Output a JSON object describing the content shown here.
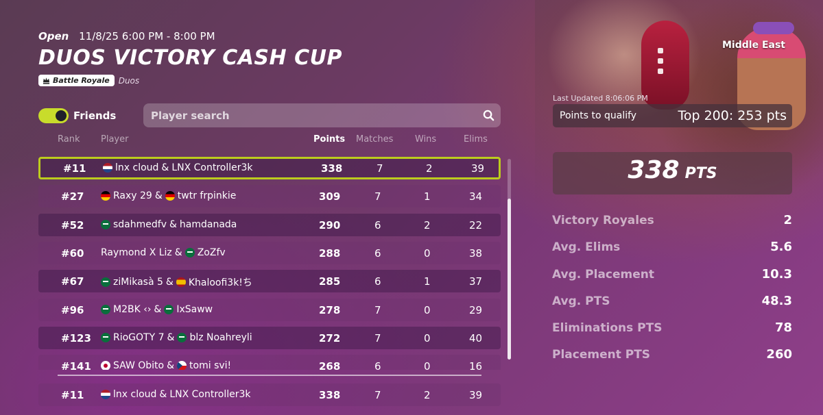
{
  "header": {
    "status": "Open",
    "time_range": "11/8/25 6:00 PM - 8:00 PM",
    "title": "DUOS VICTORY CASH CUP",
    "mode_label": "Battle Royale",
    "mode_sub": "Duos"
  },
  "hero": {
    "region": "Middle East"
  },
  "controls": {
    "friends_label": "Friends",
    "friends_toggle_on": true,
    "search_placeholder": "Player search"
  },
  "table": {
    "headers": {
      "rank": "Rank",
      "player": "Player",
      "points": "Points",
      "matches": "Matches",
      "wins": "Wins",
      "elims": "Elims"
    },
    "rows": [
      {
        "rank": "#11",
        "p1": "lnx cloud",
        "f1": "nl",
        "p2": "LNX Controller3k",
        "f2": null,
        "points": "338",
        "matches": "7",
        "wins": "2",
        "elims": "39",
        "me": true
      },
      {
        "rank": "#27",
        "p1": "Raxy 29",
        "f1": "de",
        "p2": "twtr frpinkie",
        "f2": "de",
        "points": "309",
        "matches": "7",
        "wins": "1",
        "elims": "34",
        "me": false
      },
      {
        "rank": "#52",
        "p1": "sdahmedfv",
        "f1": "sa",
        "p2": "hamdanada",
        "f2": null,
        "points": "290",
        "matches": "6",
        "wins": "2",
        "elims": "22",
        "me": false
      },
      {
        "rank": "#60",
        "p1": "Raymond X Liz",
        "f1": null,
        "p2": "ZoZfv",
        "f2": "sa",
        "points": "288",
        "matches": "6",
        "wins": "0",
        "elims": "38",
        "me": false
      },
      {
        "rank": "#67",
        "p1": "ziMikasà 5",
        "f1": "sa",
        "p2": "Khaloofi3k!ち",
        "f2": "es",
        "points": "285",
        "matches": "6",
        "wins": "1",
        "elims": "37",
        "me": false
      },
      {
        "rank": "#96",
        "p1": "M2BK ‹›",
        "f1": "sa",
        "p2": "IxSaww",
        "f2": "sa",
        "points": "278",
        "matches": "7",
        "wins": "0",
        "elims": "29",
        "me": false
      },
      {
        "rank": "#123",
        "p1": "RioGOTY 7",
        "f1": "sa",
        "p2": "blz Noahreyli",
        "f2": "sa",
        "points": "272",
        "matches": "7",
        "wins": "0",
        "elims": "40",
        "me": false
      },
      {
        "rank": "#141",
        "p1": "SAW Obito",
        "f1": "jp",
        "p2": "tomi svi!",
        "f2": "cz",
        "points": "268",
        "matches": "6",
        "wins": "0",
        "elims": "16",
        "me": false
      }
    ],
    "pinned": {
      "rank": "#11",
      "p1": "lnx cloud",
      "f1": "nl",
      "p2": "LNX Controller3k",
      "points": "338",
      "matches": "7",
      "wins": "2",
      "elims": "39"
    }
  },
  "side": {
    "last_updated": "Last Updated 8:06:06 PM",
    "qualify_label": "Points to qualify",
    "qualify_value": "Top 200: 253 pts",
    "points_value": "338",
    "points_unit": "PTS",
    "stats": [
      {
        "label": "Victory Royales",
        "value": "2"
      },
      {
        "label": "Avg. Elims",
        "value": "5.6"
      },
      {
        "label": "Avg. Placement",
        "value": "10.3"
      },
      {
        "label": "Avg. PTS",
        "value": "48.3"
      },
      {
        "label": "Eliminations PTS",
        "value": "78"
      },
      {
        "label": "Placement PTS",
        "value": "260"
      }
    ]
  },
  "colors": {
    "accent": "#c8dc2b",
    "highlight_border": "#bccc1d"
  }
}
